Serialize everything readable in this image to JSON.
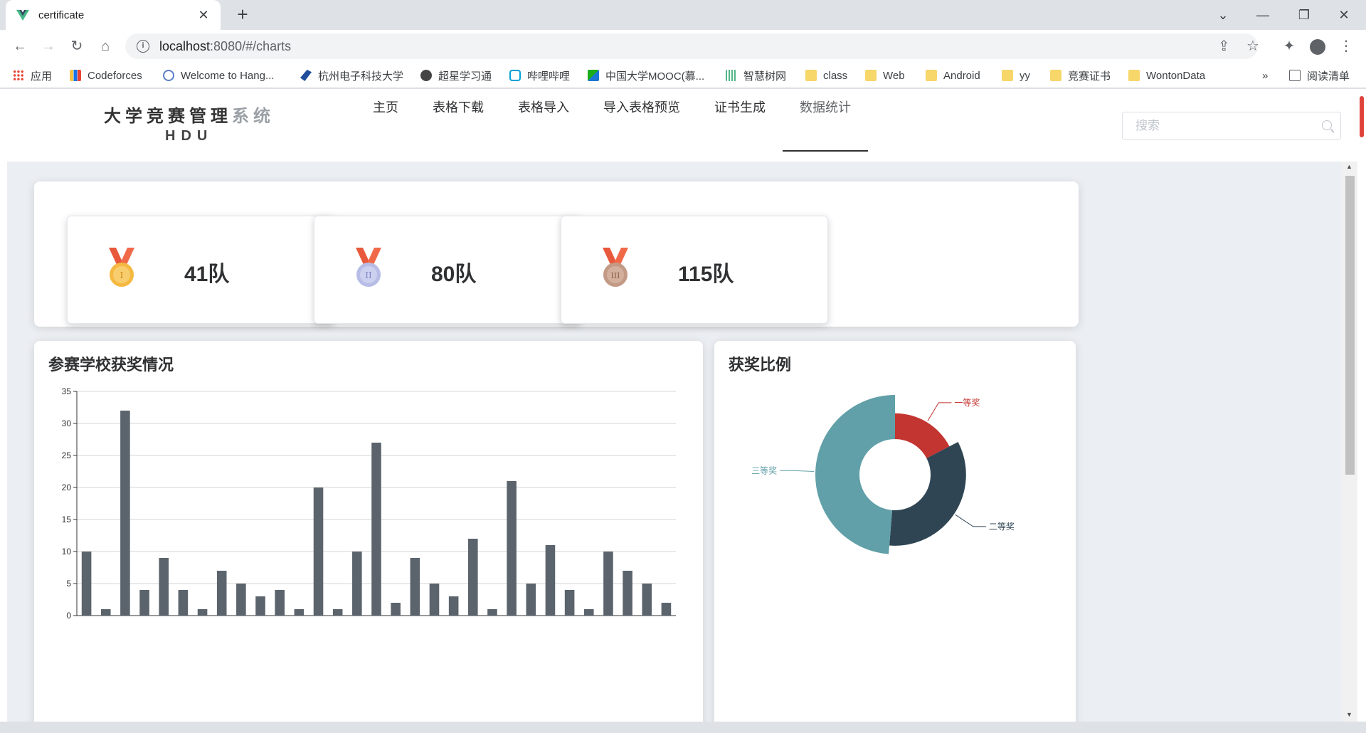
{
  "browser": {
    "tab_title": "certificate",
    "url_host": "localhost",
    "url_path": ":8080/#/charts",
    "bookmarks": [
      {
        "label": "应用",
        "icon": "apps-grid-icon",
        "color": "#ea4335"
      },
      {
        "label": "Codeforces",
        "icon": "codeforces-icon",
        "color": "#1a73e8"
      },
      {
        "label": "Welcome to Hang...",
        "icon": "hdu-icon",
        "color": "#5b7fc9"
      },
      {
        "label": "杭州电子科技大学",
        "icon": "hdu-logo-icon",
        "color": "#1f4e9c"
      },
      {
        "label": "超星学习通",
        "icon": "globe-icon",
        "color": "#444444"
      },
      {
        "label": "哔哩哔哩",
        "icon": "bilibili-icon",
        "color": "#00a1d6"
      },
      {
        "label": "中国大学MOOC(慕...",
        "icon": "mooc-icon",
        "color": "#1aad19"
      },
      {
        "label": "智慧树网",
        "icon": "zhihuishu-icon",
        "color": "#52b788"
      },
      {
        "label": "class",
        "icon": "folder-icon",
        "color": "#f7d66a"
      },
      {
        "label": "Web",
        "icon": "folder-icon",
        "color": "#f7d66a"
      },
      {
        "label": "Android",
        "icon": "folder-icon",
        "color": "#f7d66a"
      },
      {
        "label": "yy",
        "icon": "folder-icon",
        "color": "#f7d66a"
      },
      {
        "label": "竞赛证书",
        "icon": "folder-icon",
        "color": "#f7d66a"
      },
      {
        "label": "WontonData",
        "icon": "folder-icon",
        "color": "#f7d66a"
      }
    ],
    "more_bookmarks": "»",
    "reading_list": "阅读清单"
  },
  "app": {
    "logo_main": "大学竞赛管理",
    "logo_main_fade": "系统",
    "logo_sub": "HDU",
    "menu": [
      {
        "label": "主页",
        "active": false
      },
      {
        "label": "表格下载",
        "active": false
      },
      {
        "label": "表格导入",
        "active": false
      },
      {
        "label": "导入表格预览",
        "active": false
      },
      {
        "label": "证书生成",
        "active": false
      },
      {
        "label": "数据统计",
        "active": true
      }
    ],
    "search_placeholder": "搜索"
  },
  "medals": [
    {
      "count": "41队",
      "icon": "gold-medal-icon",
      "color": "#f5b942",
      "ribbon": "#e8583c"
    },
    {
      "count": "80队",
      "icon": "silver-medal-icon",
      "color": "#b7bde6",
      "ribbon": "#e8583c"
    },
    {
      "count": "115队",
      "icon": "bronze-medal-icon",
      "color": "#c29a85",
      "ribbon": "#e8583c"
    }
  ],
  "bar_card_title": "参赛学校获奖情况",
  "pie_card_title": "获奖比例",
  "chart_data": [
    {
      "type": "bar",
      "title": "参赛学校获奖情况",
      "ylim": [
        0,
        35
      ],
      "yticks": [
        0,
        5,
        10,
        15,
        20,
        25,
        30,
        35
      ],
      "values": [
        10,
        1,
        32,
        4,
        9,
        4,
        1,
        7,
        5,
        3,
        4,
        1,
        20,
        1,
        10,
        27,
        2,
        9,
        5,
        3,
        12,
        1,
        21,
        5,
        11,
        4,
        1,
        10,
        7,
        5,
        2
      ],
      "color": "#5b646c",
      "grid": true
    },
    {
      "type": "pie",
      "title": "获奖比例",
      "style": "rose-donut",
      "slices": [
        {
          "name": "一等奖",
          "value": 41,
          "color": "#c23531"
        },
        {
          "name": "二等奖",
          "value": 80,
          "color": "#2f4554"
        },
        {
          "name": "三等奖",
          "value": 115,
          "color": "#61a0a8"
        }
      ]
    }
  ]
}
